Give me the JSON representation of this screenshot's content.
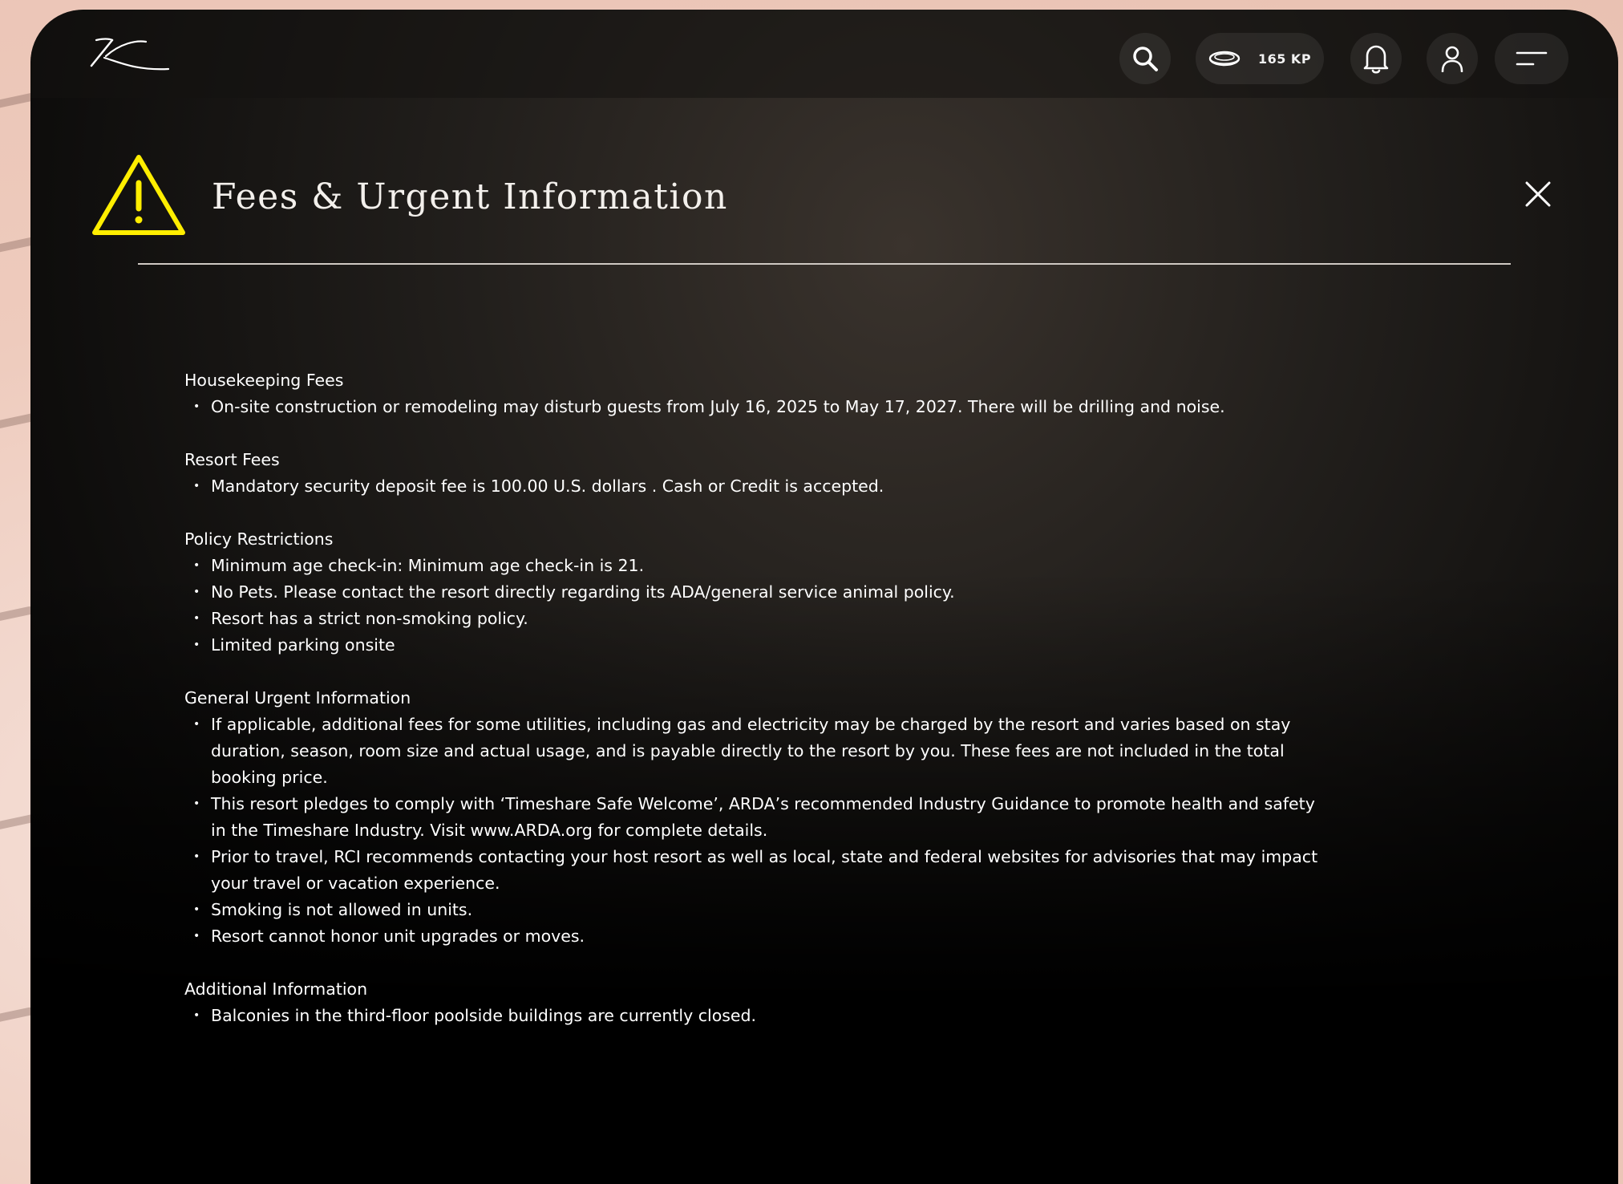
{
  "nav": {
    "points_label": "165 KP"
  },
  "modal": {
    "title": "Fees & Urgent Information",
    "sections": [
      {
        "heading": "Housekeeping Fees",
        "items": [
          "On-site construction or remodeling may disturb guests from July 16, 2025 to May 17, 2027. There will be drilling and noise."
        ]
      },
      {
        "heading": "Resort Fees",
        "items": [
          "Mandatory security deposit fee is 100.00 U.S. dollars . Cash or Credit is accepted."
        ]
      },
      {
        "heading": "Policy Restrictions",
        "items": [
          "Minimum age check-in: Minimum age check-in is 21.",
          "No Pets. Please contact the resort directly regarding its ADA/general service animal policy.",
          "Resort has a strict non-smoking policy.",
          "Limited parking onsite"
        ]
      },
      {
        "heading": "General Urgent Information",
        "items": [
          "If applicable, additional fees for some utilities, including gas and electricity may be charged by the resort and varies based on stay duration, season, room size and actual usage, and is payable directly to the resort by you. These fees are not included in the total booking price.",
          "This resort pledges to comply with ‘Timeshare Safe Welcome’, ARDA’s recommended Industry Guidance to promote health and safety in the Timeshare Industry. Visit www.ARDA.org for complete details.",
          "Prior to travel, RCI recommends contacting your host resort as well as local, state and federal websites for advisories that may impact your travel or vacation experience.",
          "Smoking is not allowed in units.",
          "Resort cannot honor unit upgrades or moves."
        ]
      },
      {
        "heading": "Additional Information",
        "items": [
          "Balconies in the third-floor poolside buildings are currently closed."
        ]
      }
    ]
  },
  "icons": {
    "logo": "k-logo",
    "search": "search-icon",
    "points": "coin-icon",
    "notifications": "bell-icon",
    "profile": "user-icon",
    "menu": "menu-icon",
    "warning": "warning-icon",
    "close": "close-icon"
  },
  "colors": {
    "warning": "#ffee00",
    "background": "#000000",
    "text": "#ffffff"
  }
}
